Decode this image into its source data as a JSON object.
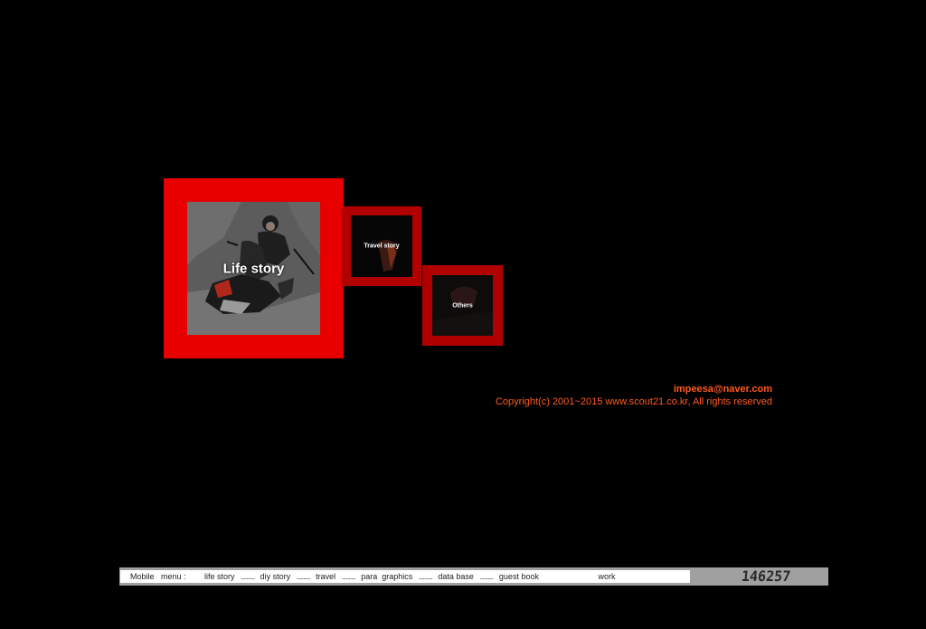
{
  "tiles": {
    "life": {
      "label": "Life story"
    },
    "travel": {
      "label": "Travel story"
    },
    "others": {
      "label": "Others"
    }
  },
  "contact": {
    "email": "impeesa@naver.com",
    "copyright": "Copyright(c) 2001~2015 www.scout21.co.kr, All rights reserved"
  },
  "menu": {
    "mobile_label": "Mobile   menu :",
    "separator": "..........",
    "items": [
      {
        "label": "life story"
      },
      {
        "label": "diy story"
      },
      {
        "label": "travel"
      },
      {
        "label": "para  graphics"
      },
      {
        "label": "data base"
      },
      {
        "label": "guest book"
      }
    ],
    "work_label": "work"
  },
  "visit_counter": "146257",
  "colors": {
    "background": "#000000",
    "life_tile": "#e80000",
    "small_tile": "#b00000",
    "contact_text": "#ff5a1f",
    "menubar": "#a0a0a0"
  }
}
